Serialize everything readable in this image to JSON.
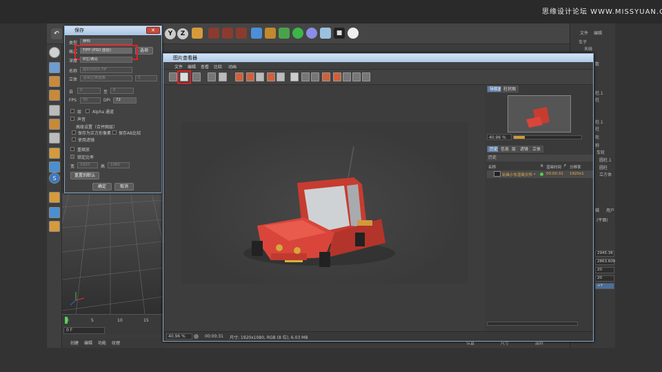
{
  "watermark": "思缘设计论坛 WWW.MISSYUAN.COM",
  "colors": {
    "highlight_red": "#e41f26",
    "title_blue": "#aec8e6",
    "car_red": "#d9453a"
  },
  "save_dialog": {
    "title": "保存",
    "type_label": "类型",
    "type_value": "静帧",
    "format_label": "格式",
    "format_value": "TIFF (PSD 图层)",
    "options_button": "选项",
    "depth_label": "深度",
    "depth_value": "8位/通道",
    "name_label": "名称",
    "name_value": "图形0000.TIF",
    "stereo_label": "立体",
    "stereo_value": "渲染立体图像",
    "stereo_number": "2",
    "from_label": "自",
    "from_value": "0",
    "to_label": "至",
    "to_value": "0",
    "fps_label": "FPS",
    "fps_value": "30",
    "dpi_label": "DPI",
    "dpi_value": "72",
    "layers_label": "层",
    "alpha_label": "Alpha 通道",
    "sound_label": "声音",
    "advanced_label": "高级设置（合并图层）",
    "square_label": "保存为正方形像素",
    "save_ab_label": "保存AB比较",
    "filter_label": "使用滤镜",
    "scale_label": "重缩放",
    "ratio_label": "锁定比率",
    "width_label": "宽",
    "width_value": "1920",
    "height_label": "高",
    "height_value": "1080",
    "reset_button": "重置到默认",
    "ok_button": "确定",
    "cancel_button": "取消"
  },
  "viewer": {
    "title": "图片查看器",
    "menu": [
      "文件",
      "编辑",
      "查看",
      "比较",
      "动画"
    ],
    "zoom": "40.96 %",
    "time": "00:00:31",
    "size_info": "尺寸: 1920x1080, RGB (8 位), 6.03 MB",
    "tabs_top": [
      "导航器",
      "柱状图"
    ],
    "nav_zoom": "40.96 %",
    "tabs_bottom": [
      "历史",
      "信息",
      "层",
      "滤镜",
      "立体"
    ],
    "history_title": "历史",
    "history_columns": [
      "名称",
      "R",
      "渲染时间",
      "F",
      "分辨率"
    ],
    "history_row": {
      "name": "玩具小车渲染文件 *",
      "time": "00:00:31",
      "res": "1920x1"
    }
  },
  "c4d": {
    "toolbar_icons": [
      "undo-icon",
      "y-axis-icon",
      "z-axis-icon",
      "cube-icon",
      "render-region-icon",
      "render-view-icon",
      "render-settings-icon",
      "primitive-cube-icon",
      "pen-icon",
      "subdivide-icon",
      "generator-icon",
      "deformer-icon",
      "floor-icon",
      "camera-icon",
      "light-icon"
    ],
    "axis_y": "Y",
    "axis_z": "Z",
    "timeline_ticks": [
      "0",
      "5",
      "10",
      "15"
    ],
    "frame_field": "0 F",
    "bottom_menu": [
      "创建",
      "编辑",
      "功能",
      "纹理"
    ],
    "bottom_right_tabs": [
      "位置",
      "尺寸",
      "旋转"
    ],
    "right": {
      "menu": [
        "文件",
        "编辑"
      ],
      "obj1": "车子",
      "obj2": "天线",
      "labels": [
        "数",
        "柱.1",
        "柱",
        "柱.1",
        "柱",
        "轮",
        "称",
        "车轮",
        "圆柱.1",
        "圆柱",
        "立方体"
      ],
      "bottom_labels": [
        "辑",
        "用户",
        "(平面)"
      ],
      "values": [
        "2945.38",
        "2863.600",
        "20",
        "20"
      ],
      "axis_btn": "+Y"
    }
  }
}
